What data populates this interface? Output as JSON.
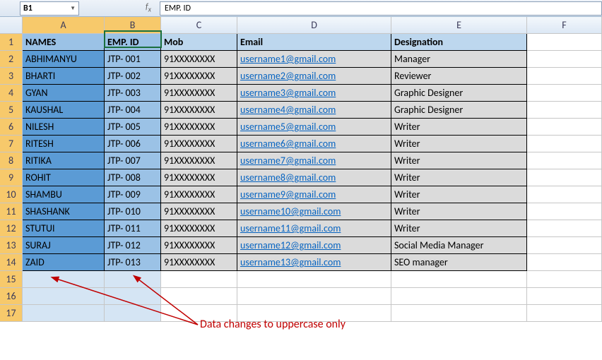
{
  "name_box": "B1",
  "formula_value": "EMP. ID",
  "col_headers": [
    "A",
    "B",
    "C",
    "D",
    "E",
    "F"
  ],
  "header_row": {
    "A": "NAMES",
    "B": "EMP. ID",
    "C": "Mob",
    "D": "Email",
    "E": "Designation"
  },
  "rows": [
    {
      "A": "ABHIMANYU",
      "B": "JTP- 001",
      "C": "91XXXXXXXX",
      "D": "username1@gmail.com",
      "E": "Manager"
    },
    {
      "A": "BHARTI",
      "B": "JTP- 002",
      "C": "91XXXXXXXX",
      "D": "username2@gmail.com",
      "E": "Reviewer"
    },
    {
      "A": "GYAN",
      "B": "JTP- 003",
      "C": "91XXXXXXXX",
      "D": "username3@gmail.com",
      "E": "Graphic Designer"
    },
    {
      "A": "KAUSHAL",
      "B": "JTP- 004",
      "C": "91XXXXXXXX",
      "D": "username4@gmail.com",
      "E": "Graphic Designer"
    },
    {
      "A": "NILESH",
      "B": "JTP- 005",
      "C": "91XXXXXXXX",
      "D": "username5@gmail.com",
      "E": "Writer"
    },
    {
      "A": "RITESH",
      "B": "JTP- 006",
      "C": "91XXXXXXXX",
      "D": "username6@gmail.com",
      "E": "Writer"
    },
    {
      "A": "RITIKA",
      "B": "JTP- 007",
      "C": "91XXXXXXXX",
      "D": "username7@gmail.com",
      "E": "Writer"
    },
    {
      "A": "ROHIT",
      "B": "JTP- 008",
      "C": "91XXXXXXXX",
      "D": "username8@gmail.com",
      "E": "Writer"
    },
    {
      "A": "SHAMBU",
      "B": "JTP- 009",
      "C": "91XXXXXXXX",
      "D": "username9@gmail.com",
      "E": "Writer"
    },
    {
      "A": "SHASHANK",
      "B": "JTP- 010",
      "C": "91XXXXXXXX",
      "D": "username10@gmail.com",
      "E": "Writer"
    },
    {
      "A": "STUTUI",
      "B": "JTP- 011",
      "C": "91XXXXXXXX",
      "D": "username11@gmail.com",
      "E": "Writer"
    },
    {
      "A": "SURAJ",
      "B": "JTP- 012",
      "C": "91XXXXXXXX",
      "D": "username12@gmail.com",
      "E": "Social Media Manager"
    },
    {
      "A": "ZAID",
      "B": "JTP- 013",
      "C": "91XXXXXXXX",
      "D": "username13@gmail.com",
      "E": "SEO manager"
    }
  ],
  "empty_rows": [
    15,
    16,
    17
  ],
  "annotation_text": "Data changes to uppercase only"
}
